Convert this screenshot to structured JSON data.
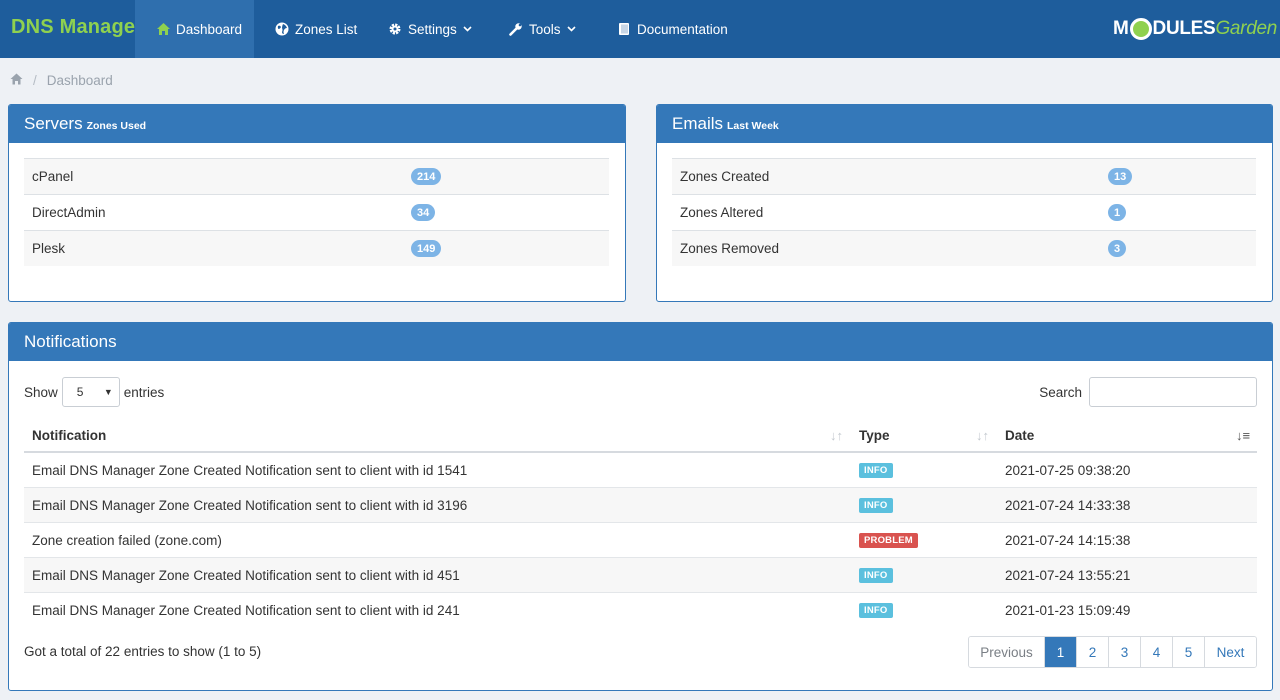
{
  "app": {
    "brand": "DNS Manager",
    "logo_main": "M",
    "logo_rest": "DULES",
    "logo_garden": "Garden"
  },
  "nav": {
    "items": [
      {
        "label": "Dashboard",
        "icon": "home-icon"
      },
      {
        "label": "Zones List",
        "icon": "globe-icon"
      },
      {
        "label": "Settings",
        "icon": "gear-icon"
      },
      {
        "label": "Tools",
        "icon": "wrench-icon"
      },
      {
        "label": "Documentation",
        "icon": "book-icon"
      }
    ]
  },
  "breadcrumb": {
    "current": "Dashboard",
    "separator": "/"
  },
  "servers": {
    "title": "Servers",
    "subtitle": "Zones Used",
    "rows": [
      {
        "label": "cPanel",
        "count": "214"
      },
      {
        "label": "DirectAdmin",
        "count": "34"
      },
      {
        "label": "Plesk",
        "count": "149"
      }
    ]
  },
  "emails": {
    "title": "Emails",
    "subtitle": "Last Week",
    "rows": [
      {
        "label": "Zones Created",
        "count": "13"
      },
      {
        "label": "Zones Altered",
        "count": "1"
      },
      {
        "label": "Zones Removed",
        "count": "3"
      }
    ]
  },
  "notifications": {
    "title": "Notifications",
    "show_label": "Show",
    "entries_label": "entries",
    "page_size": "5",
    "search_label": "Search",
    "search_value": "",
    "columns": [
      "Notification",
      "Type",
      "Date"
    ],
    "rows": [
      {
        "text": "Email DNS Manager Zone Created Notification sent to client with id 1541",
        "type": "INFO",
        "date": "2021-07-25 09:38:20"
      },
      {
        "text": "Email DNS Manager Zone Created Notification sent to client with id 3196",
        "type": "INFO",
        "date": "2021-07-24 14:33:38"
      },
      {
        "text": "Zone creation failed (zone.com)",
        "type": "PROBLEM",
        "date": "2021-07-24 14:15:38"
      },
      {
        "text": "Email DNS Manager Zone Created Notification sent to client with id 451",
        "type": "INFO",
        "date": "2021-07-24 13:55:21"
      },
      {
        "text": "Email DNS Manager Zone Created Notification sent to client with id 241",
        "type": "INFO",
        "date": "2021-01-23 15:09:49"
      }
    ],
    "total_text": "Got a total of 22 entries to show (1 to 5)",
    "pagination": {
      "previous": "Previous",
      "pages": [
        "1",
        "2",
        "3",
        "4",
        "5"
      ],
      "current": "1",
      "next": "Next"
    }
  },
  "colors": {
    "navbar": "#1e5d9c",
    "panel_header": "#3478b9",
    "brand_green": "#8fd14f",
    "info": "#5bc0de",
    "problem": "#d9534f",
    "badge": "#7db4e6"
  }
}
